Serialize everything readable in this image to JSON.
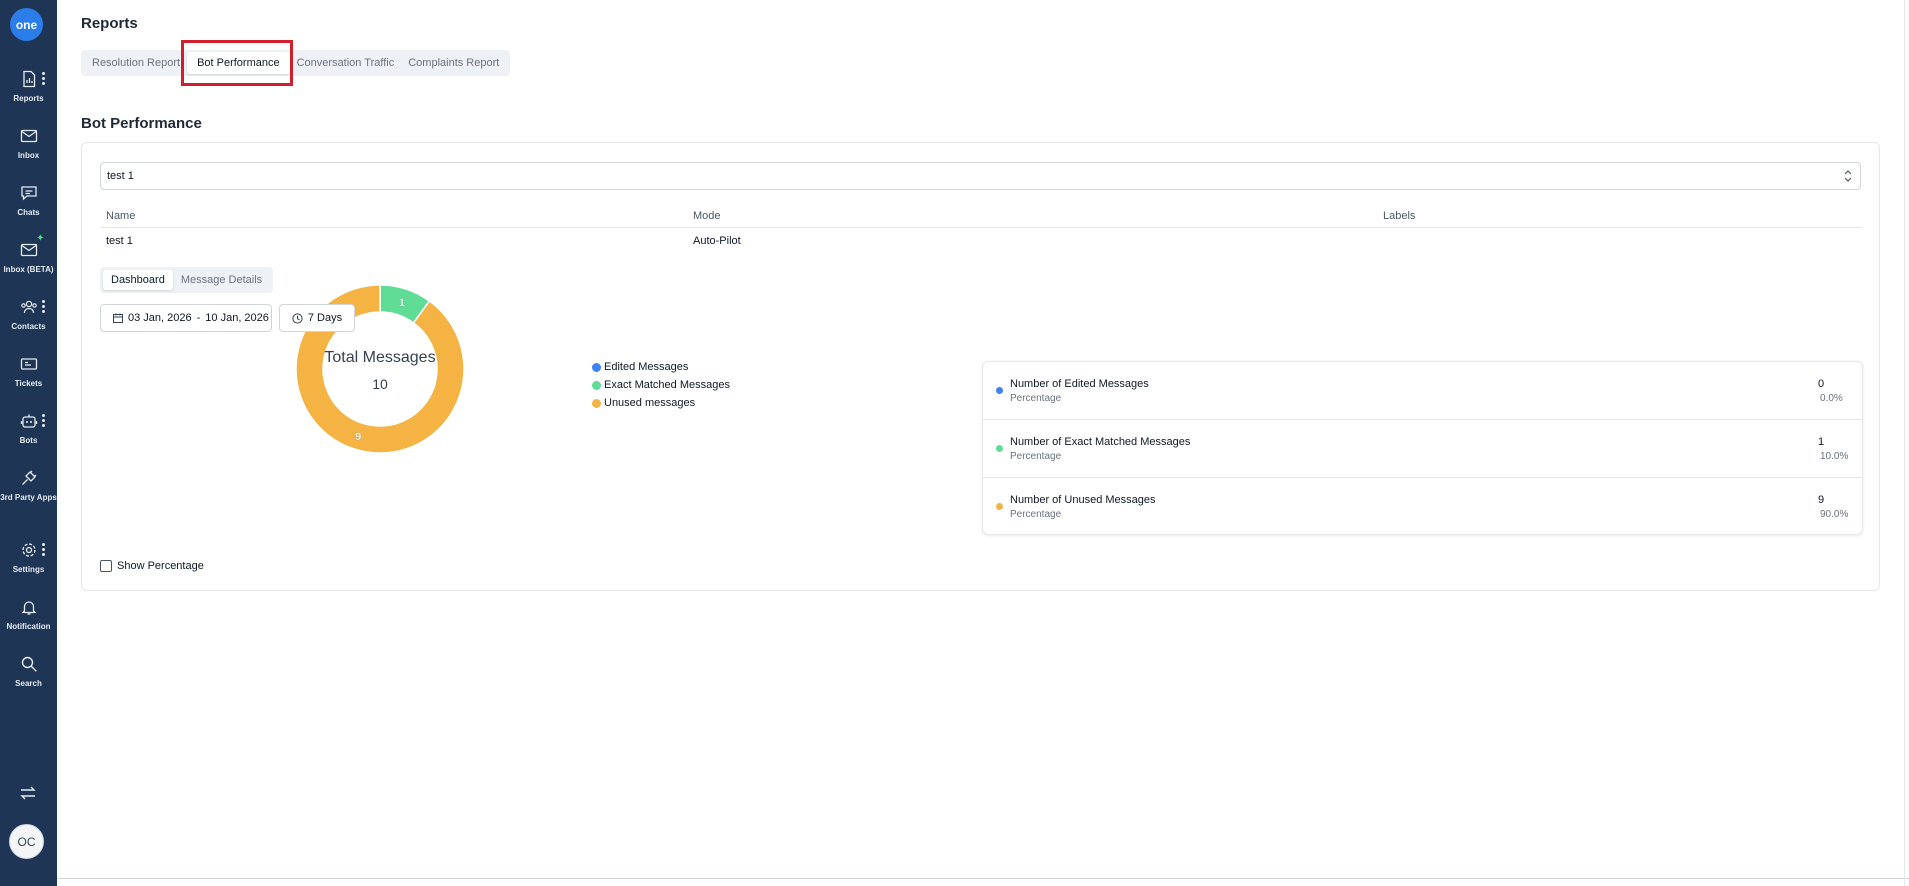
{
  "logo": {
    "text": "one"
  },
  "sidebar": {
    "items": [
      {
        "label": "Reports"
      },
      {
        "label": "Inbox"
      },
      {
        "label": "Chats"
      },
      {
        "label": "Inbox (BETA)"
      },
      {
        "label": "Contacts"
      },
      {
        "label": "Tickets"
      },
      {
        "label": "Bots"
      },
      {
        "label": "3rd Party Apps"
      },
      {
        "label": "Settings"
      },
      {
        "label": "Notification"
      },
      {
        "label": "Search"
      }
    ],
    "avatar": "OC"
  },
  "page": {
    "title": "Reports"
  },
  "report_tabs": [
    {
      "label": "Resolution Report"
    },
    {
      "label": "Bot Performance",
      "active": true
    },
    {
      "label": "Conversation Traffic"
    },
    {
      "label": "Complaints Report"
    }
  ],
  "section": {
    "title": "Bot Performance"
  },
  "bot_select": {
    "value": "test 1"
  },
  "table": {
    "headers": {
      "name": "Name",
      "mode": "Mode",
      "labels": "Labels"
    },
    "row": {
      "name": "test 1",
      "mode": "Auto-Pilot",
      "labels": ""
    }
  },
  "sub_tabs": [
    {
      "label": "Dashboard",
      "active": true
    },
    {
      "label": "Message Details"
    }
  ],
  "date_range": {
    "start": "03 Jan, 2026",
    "separator": "-",
    "end": "10 Jan, 2026"
  },
  "period": {
    "label": "7 Days"
  },
  "chart_data": {
    "type": "pie",
    "center_title": "Total Messages",
    "center_value": "10",
    "categories": [
      "Edited Messages",
      "Exact Matched Messages",
      "Unused messages"
    ],
    "values": [
      0,
      1,
      9
    ],
    "colors": [
      "#3b82f6",
      "#5fdc95",
      "#f4b342"
    ],
    "slice_labels": [
      "",
      "1",
      "9"
    ],
    "legend": "right"
  },
  "stats": [
    {
      "label": "Number of Edited Messages",
      "sub": "Percentage",
      "value": "0",
      "pct": "0.0%",
      "color": "#3b82f6"
    },
    {
      "label": "Number of Exact Matched Messages",
      "sub": "Percentage",
      "value": "1",
      "pct": "10.0%",
      "color": "#5fdc95"
    },
    {
      "label": "Number of Unused Messages",
      "sub": "Percentage",
      "value": "9",
      "pct": "90.0%",
      "color": "#f4b342"
    }
  ],
  "show_percentage": {
    "label": "Show Percentage",
    "checked": false
  }
}
